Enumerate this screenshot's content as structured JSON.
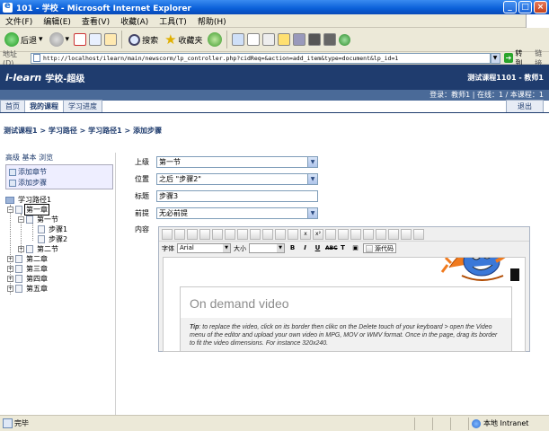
{
  "window": {
    "title": "101 - 学校 - Microsoft Internet Explorer"
  },
  "menu": [
    "文件(F)",
    "编辑(E)",
    "查看(V)",
    "收藏(A)",
    "工具(T)",
    "帮助(H)"
  ],
  "toolbar": {
    "back": "后退",
    "search": "搜索",
    "favorites": "收藏夹"
  },
  "address": {
    "label": "地址(D)",
    "url": "http://localhost/ilearn/main/newscorm/lp_controller.php?cidReq=&action=add_item&type=document&lp_id=1",
    "go": "转到",
    "links": "链接"
  },
  "header": {
    "logo": "i-learn",
    "logo_suffix": "学校-超级",
    "course": "测试课程1101 - 教师1",
    "user_line": "登录：教师1 | 在线：1 / 本课程：1"
  },
  "nav": {
    "tabs": [
      "首页",
      "我的课程",
      "学习进度"
    ],
    "active": 1,
    "logout": "退出"
  },
  "breadcrumb": "测试课程1 > 学习路径 > 学习路径1 > 添加步骤",
  "left": {
    "mode_line": "高级 基本 浏览",
    "actions": [
      "添加章节",
      "添加步骤"
    ],
    "tree": [
      {
        "label": "学习路径1",
        "level": 0
      },
      {
        "label": "第一章",
        "level": 1
      },
      {
        "label": "第一节",
        "level": 2
      },
      {
        "label": "步骤1",
        "level": 3
      },
      {
        "label": "步骤2",
        "level": 3
      },
      {
        "label": "第二节",
        "level": 2
      },
      {
        "label": "第二章",
        "level": 1
      },
      {
        "label": "第三章",
        "level": 1
      },
      {
        "label": "第四章",
        "level": 1
      },
      {
        "label": "第五章",
        "level": 1
      }
    ]
  },
  "form": {
    "parent_label": "上级",
    "parent_value": "第一节",
    "position_label": "位置",
    "position_value": "之后 \"步骤2\"",
    "title_label": "标题",
    "title_value": "步骤3",
    "prereq_label": "前提",
    "prereq_value": "无必前提",
    "content_label": "内容"
  },
  "editor": {
    "font_label": "字体",
    "font_value": "Arial",
    "size_label": "大小",
    "source_label": "源代码",
    "video_title": "On demand video",
    "tip_label": "Tip",
    "tip_text": ": to replace the video, click on its border then clikc on the Delete touch of your keyboard > open the Video menu of the editor and upload your own video in MPG, MOV or WMV format. Once in the page, drag its border to fit the video dimensions. For instance 320x240."
  },
  "status": {
    "text": "完毕",
    "zone": "本地 Intranet"
  }
}
